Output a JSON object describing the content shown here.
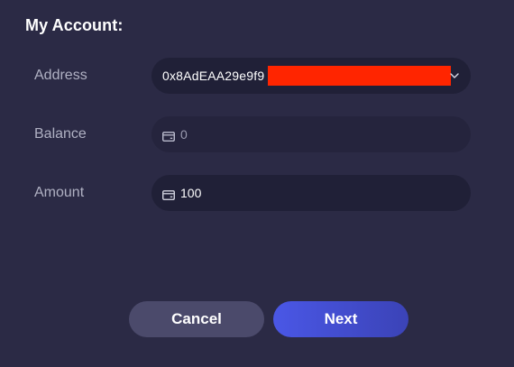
{
  "account": {
    "title": "My Account:",
    "address": {
      "label": "Address",
      "value": "0x8AdEAA29e9f9",
      "chevron_icon": "chevron-down-icon"
    },
    "balance": {
      "label": "Balance",
      "value": "0",
      "icon": "card-icon"
    },
    "amount": {
      "label": "Amount",
      "value": "100",
      "icon": "card-icon"
    }
  },
  "actions": {
    "cancel_label": "Cancel",
    "next_label": "Next"
  },
  "colors": {
    "background": "#2b2a45",
    "field": "#202037",
    "label": "#b0b1c3",
    "cancel": "#4b4a6b",
    "next_start": "#4a57e6",
    "next_end": "#3b43b7",
    "redaction": "#ff2500"
  }
}
